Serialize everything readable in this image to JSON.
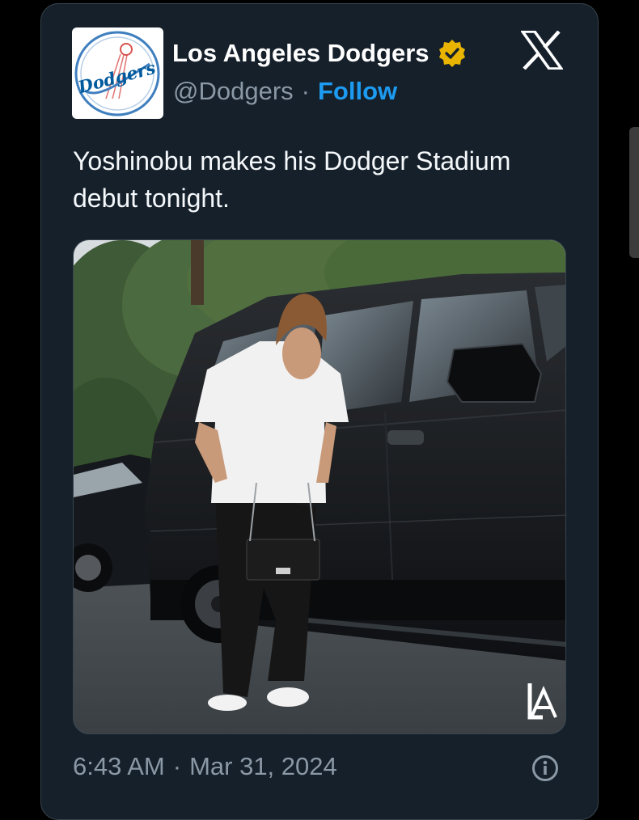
{
  "account": {
    "name": "Los Angeles Dodgers",
    "handle": "@Dodgers",
    "separator": "·",
    "follow_label": "Follow",
    "avatar_icon": "dodgers-logo-icon",
    "verified_icon": "gold-verified-badge-icon"
  },
  "platform_icon": "x-logo-icon",
  "tweet": {
    "text_line1": "Yoshinobu makes his Dodger Stadium",
    "text_line2": "debut tonight."
  },
  "media": {
    "watermark_icon": "la-logo-icon"
  },
  "meta": {
    "time": "6:43 AM",
    "separator": "·",
    "date": "Mar 31, 2024",
    "info_icon": "info-icon"
  },
  "colors": {
    "background": "#000000",
    "card": "#15202b",
    "text": "#ffffff",
    "muted": "#8b98a5",
    "accent": "#1d9bf0",
    "verified": "#e8b400",
    "dodger_blue": "#005a9c"
  }
}
